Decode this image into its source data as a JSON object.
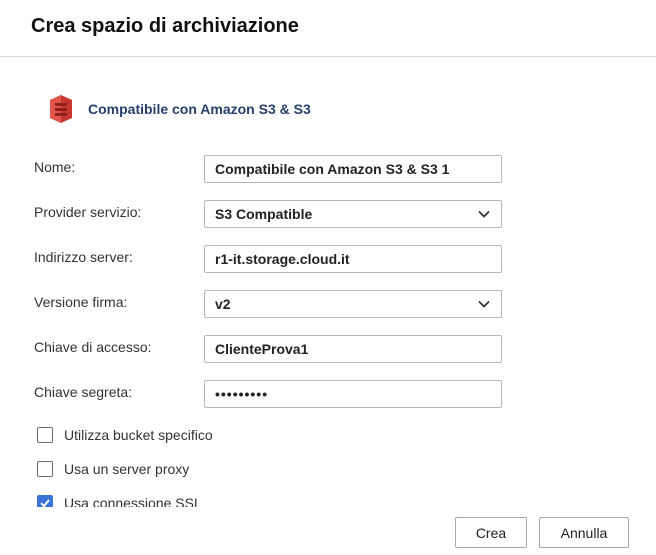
{
  "dialog": {
    "title": "Crea spazio di archiviazione"
  },
  "service": {
    "icon": "amazon-s3-icon",
    "name": "Compatibile con Amazon S3 & S3",
    "icon_color": "#c7372f"
  },
  "form": {
    "name": {
      "label": "Nome:",
      "value": "Compatibile con Amazon S3 & S3 1"
    },
    "provider": {
      "label": "Provider servizio:",
      "value": "S3 Compatible"
    },
    "server": {
      "label": "Indirizzo server:",
      "value": "r1-it.storage.cloud.it"
    },
    "signature": {
      "label": "Versione firma:",
      "value": "v2"
    },
    "access_key": {
      "label": "Chiave di accesso:",
      "value": "ClienteProva1"
    },
    "secret_key": {
      "label": "Chiave segreta:",
      "value": "•••••••••"
    }
  },
  "options": {
    "specific_bucket": {
      "label": "Utilizza bucket specifico",
      "checked": false
    },
    "proxy": {
      "label": "Usa un server proxy",
      "checked": false
    },
    "ssl": {
      "label": "Usa connessione SSL",
      "checked": true
    }
  },
  "buttons": {
    "create": "Crea",
    "cancel": "Annulla"
  },
  "colors": {
    "accent": "#3b73d9",
    "service_text": "#26406b"
  }
}
